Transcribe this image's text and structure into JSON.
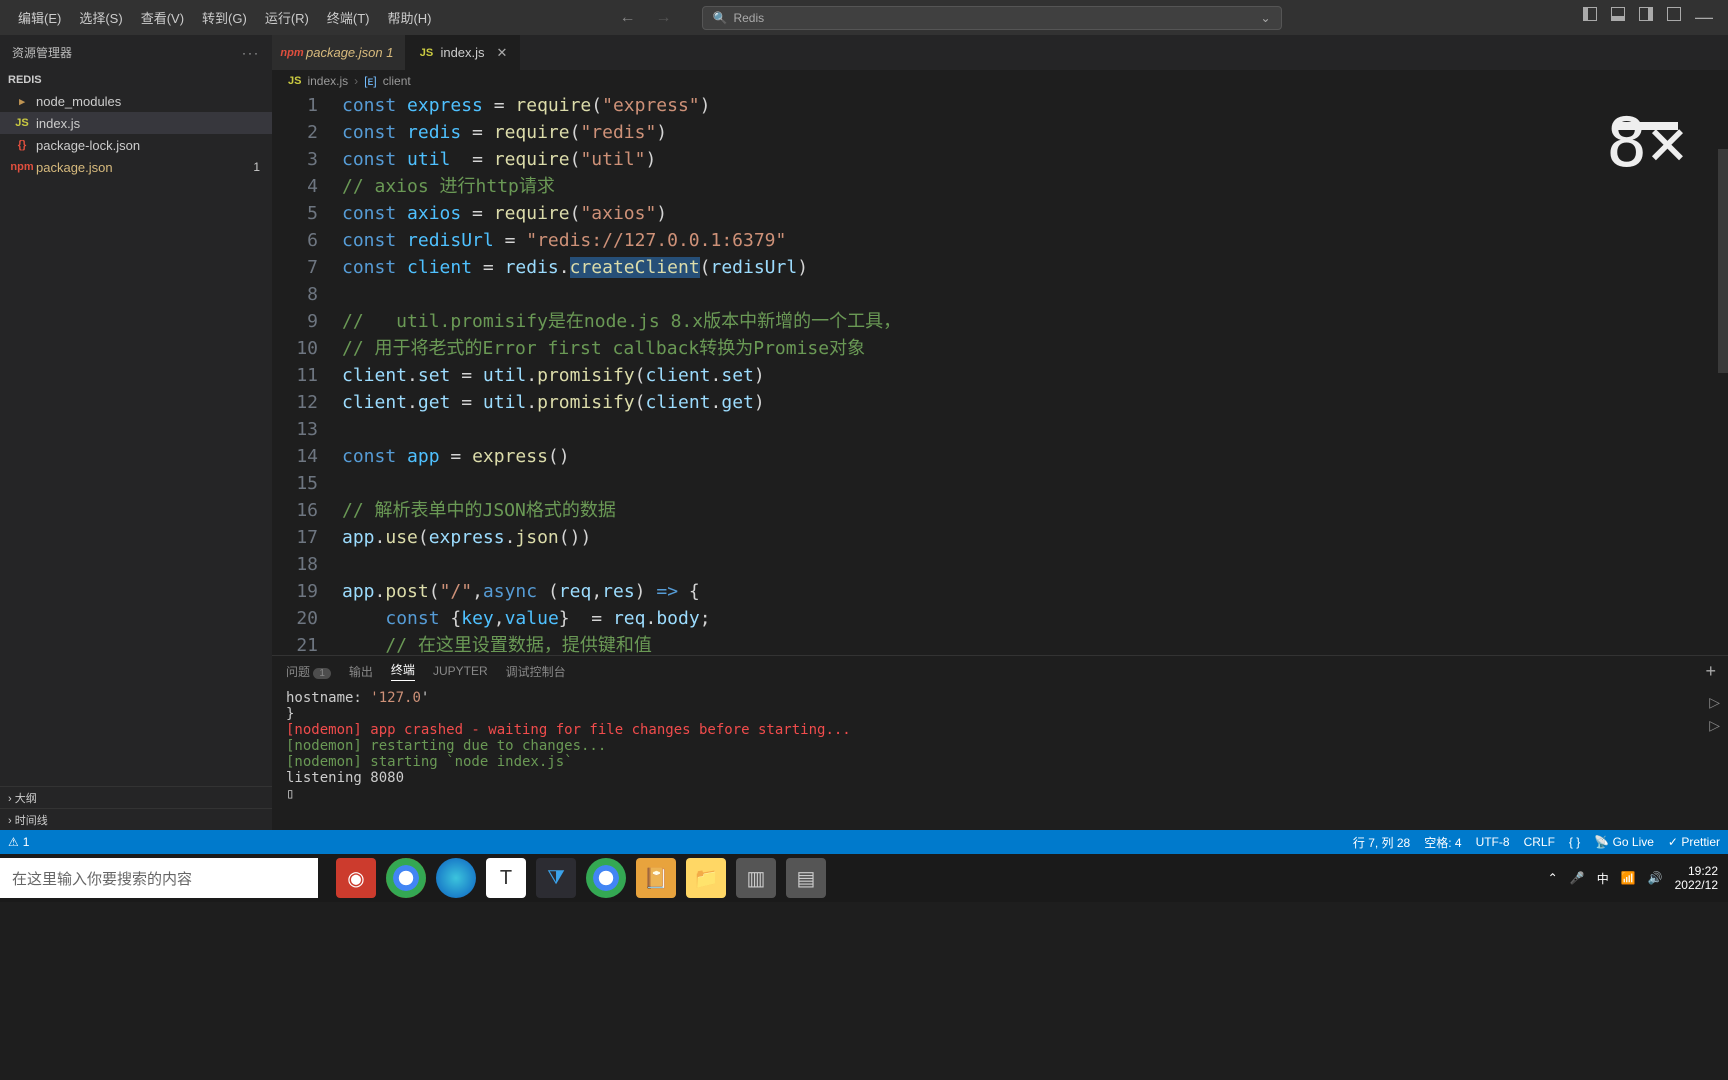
{
  "menubar": [
    "编辑(E)",
    "选择(S)",
    "查看(V)",
    "转到(G)",
    "运行(R)",
    "终端(T)",
    "帮助(H)"
  ],
  "search_value": "Redis",
  "sidebar": {
    "title": "资源管理器",
    "section": "REDIS",
    "items": [
      {
        "icon": "folder",
        "label": "node_modules",
        "modified": false,
        "active": false
      },
      {
        "icon": "js",
        "label": "index.js",
        "modified": false,
        "active": true
      },
      {
        "icon": "json",
        "label": "package-lock.json",
        "modified": false,
        "active": false
      },
      {
        "icon": "pkg",
        "label": "package.json",
        "modified": true,
        "active": false,
        "badge": "1"
      }
    ],
    "bottom": [
      "大纲",
      "时间线"
    ]
  },
  "tabs": [
    {
      "type": "pkg",
      "label": "package.json",
      "suffix": "1",
      "modified": true,
      "active": false
    },
    {
      "type": "js",
      "label": "index.js",
      "modified": false,
      "active": true
    }
  ],
  "breadcrumb": {
    "file": "index.js",
    "symbol": "client"
  },
  "code_lines": [
    {
      "n": 1,
      "html": "<span class='kw'>const</span> <span class='ty'>express</span> = <span class='fn'>require</span>(<span class='str'>\"express\"</span>)"
    },
    {
      "n": 2,
      "html": "<span class='kw'>const</span> <span class='ty'>redis</span> = <span class='fn'>require</span>(<span class='str'>\"redis\"</span>)"
    },
    {
      "n": 3,
      "html": "<span class='kw'>const</span> <span class='ty'>util</span>  = <span class='fn'>require</span>(<span class='str'>\"util\"</span>)"
    },
    {
      "n": 4,
      "html": "<span class='cm'>// axios 进行http请求</span>"
    },
    {
      "n": 5,
      "html": "<span class='kw'>const</span> <span class='ty'>axios</span> = <span class='fn'>require</span>(<span class='str'>\"axios\"</span>)"
    },
    {
      "n": 6,
      "html": "<span class='kw'>const</span> <span class='ty'>redisUrl</span> = <span class='str'>\"redis://127.0.0.1:6379\"</span>"
    },
    {
      "n": 7,
      "html": "<span class='kw'>const</span> <span class='ty'>client</span> = <span class='va'>redis</span>.<span class='fn hl'>createClient</span>(<span class='va'>redisUrl</span>)"
    },
    {
      "n": 8,
      "html": ""
    },
    {
      "n": 9,
      "html": "<span class='cm'>//   util.promisify是在node.js 8.x版本中新增的一个工具，</span>"
    },
    {
      "n": 10,
      "html": "<span class='cm'>// 用于将老式的Error first callback转换为Promise对象</span>"
    },
    {
      "n": 11,
      "html": "<span class='va'>client</span>.<span class='pr'>set</span> = <span class='va'>util</span>.<span class='fn'>promisify</span>(<span class='va'>client</span>.<span class='pr'>set</span>)"
    },
    {
      "n": 12,
      "html": "<span class='va'>client</span>.<span class='pr'>get</span> = <span class='va'>util</span>.<span class='fn'>promisify</span>(<span class='va'>client</span>.<span class='pr'>get</span>)"
    },
    {
      "n": 13,
      "html": ""
    },
    {
      "n": 14,
      "html": "<span class='kw'>const</span> <span class='ty'>app</span> = <span class='fn'>express</span>()"
    },
    {
      "n": 15,
      "html": ""
    },
    {
      "n": 16,
      "html": "<span class='cm'>// 解析表单中的JSON格式的数据</span>"
    },
    {
      "n": 17,
      "html": "<span class='va'>app</span>.<span class='fn'>use</span>(<span class='va'>express</span>.<span class='fn'>json</span>())"
    },
    {
      "n": 18,
      "html": ""
    },
    {
      "n": 19,
      "html": "<span class='va'>app</span>.<span class='fn'>post</span>(<span class='str'>\"/\"</span>,<span class='kw'>async</span> (<span class='va'>req</span>,<span class='va'>res</span>) <span class='kw'>=&gt;</span> {"
    },
    {
      "n": 20,
      "html": "    <span class='kw'>const</span> {<span class='ty'>key</span>,<span class='ty'>value</span>}  = <span class='va'>req</span>.<span class='pr'>body</span>;"
    },
    {
      "n": 21,
      "html": "    <span class='cm'>// 在这里设置数据，提供键和值</span>"
    }
  ],
  "speed": "8×",
  "panel_tabs": [
    {
      "label": "问题",
      "badge": "1"
    },
    {
      "label": "输出"
    },
    {
      "label": "终端",
      "active": true
    },
    {
      "label": "JUPYTER"
    },
    {
      "label": "调试控制台"
    }
  ],
  "terminal_lines": [
    {
      "cls": "",
      "html": "  hostname: <span class='val'>'127.0</span>'"
    },
    {
      "cls": "",
      "html": "}"
    },
    {
      "cls": "err",
      "html": "[nodemon] app crashed - waiting for file changes before starting..."
    },
    {
      "cls": "ok",
      "html": "[nodemon] restarting due to changes..."
    },
    {
      "cls": "ok",
      "html": "[nodemon] starting `node index.js`"
    },
    {
      "cls": "",
      "html": "listening 8080"
    },
    {
      "cls": "",
      "html": "▯"
    }
  ],
  "status": {
    "warnings": "1",
    "cursor": "行 7, 列 28",
    "spaces": "空格: 4",
    "encoding": "UTF-8",
    "eol": "CRLF",
    "lang": "{ }",
    "golive": "Go Live",
    "prettier": "Prettier"
  },
  "taskbar": {
    "search_placeholder": "在这里输入你要搜索的内容",
    "ime": "中",
    "time": "19:22",
    "date": "2022/12"
  }
}
